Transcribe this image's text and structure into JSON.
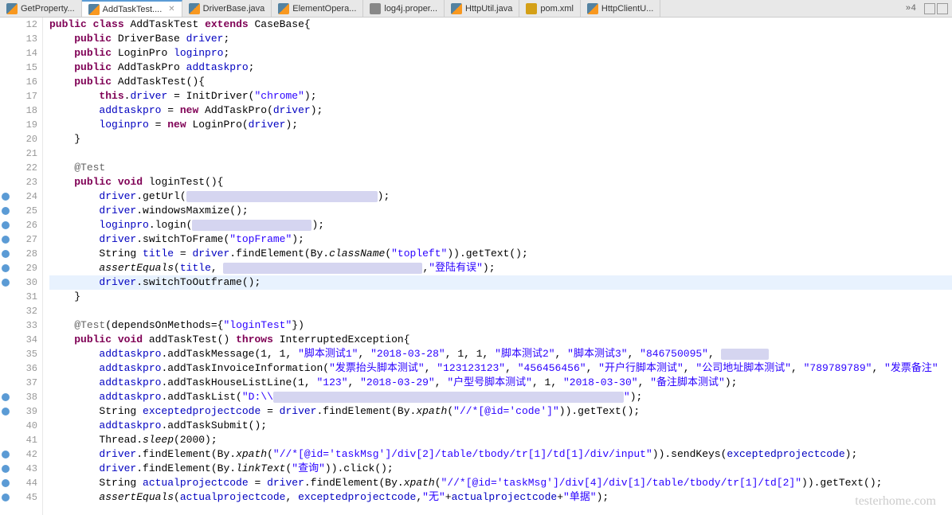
{
  "tabs": [
    {
      "label": "GetProperty...",
      "icon": "java",
      "active": false
    },
    {
      "label": "AddTaskTest....",
      "icon": "java",
      "active": true,
      "closable": true
    },
    {
      "label": "DriverBase.java",
      "icon": "java",
      "active": false
    },
    {
      "label": "ElementOpera...",
      "icon": "java",
      "active": false
    },
    {
      "label": "log4j.proper...",
      "icon": "props",
      "active": false
    },
    {
      "label": "HttpUtil.java",
      "icon": "java",
      "active": false
    },
    {
      "label": "pom.xml",
      "icon": "xml",
      "active": false
    },
    {
      "label": "HttpClientU...",
      "icon": "java",
      "active": false
    }
  ],
  "tabs_more": "»4",
  "watermark": "testerhome.com",
  "lines": [
    {
      "n": 12,
      "html": "<span class='kw'>public</span> <span class='kw'>class</span> AddTaskTest <span class='kw'>extends</span> CaseBase{"
    },
    {
      "n": 13,
      "html": "    <span class='kw'>public</span> DriverBase <span class='field'>driver</span>;"
    },
    {
      "n": 14,
      "html": "    <span class='kw'>public</span> LoginPro <span class='field'>loginpro</span>;"
    },
    {
      "n": 15,
      "html": "    <span class='kw'>public</span> AddTaskPro <span class='field'>addtaskpro</span>;"
    },
    {
      "n": 16,
      "html": "    <span class='kw'>public</span> AddTaskTest(){",
      "fold": true
    },
    {
      "n": 17,
      "html": "        <span class='kw'>this</span>.<span class='field'>driver</span> = InitDriver(<span class='str'>\"chrome\"</span>);"
    },
    {
      "n": 18,
      "html": "        <span class='field'>addtaskpro</span> = <span class='kw'>new</span> AddTaskPro(<span class='field'>driver</span>);"
    },
    {
      "n": 19,
      "html": "        <span class='field'>loginpro</span> = <span class='kw'>new</span> LoginPro(<span class='field'>driver</span>);"
    },
    {
      "n": 20,
      "html": "    }"
    },
    {
      "n": 21,
      "html": ""
    },
    {
      "n": 22,
      "html": "    <span class='ann'>@Test</span>",
      "fold": true
    },
    {
      "n": 23,
      "html": "    <span class='kw'>public</span> <span class='kw'>void</span> loginTest(){"
    },
    {
      "n": 24,
      "html": "        <span class='field'>driver</span>.getUrl(<span class='redacted' style='width:240px'></span>);",
      "bp": true
    },
    {
      "n": 25,
      "html": "        <span class='field'>driver</span>.windowsMaxmize();",
      "bp": true
    },
    {
      "n": 26,
      "html": "        <span class='field'>loginpro</span>.login(<span class='redacted' style='width:150px'></span>);",
      "bp": true
    },
    {
      "n": 27,
      "html": "        <span class='field'>driver</span>.switchToFrame(<span class='str'>\"topFrame\"</span>);",
      "bp": true
    },
    {
      "n": 28,
      "html": "        String <span class='field'>title</span> = <span class='field'>driver</span>.findElement(By.<span class='static-method'>className</span>(<span class='str'>\"topleft\"</span>)).getText();",
      "bp": true
    },
    {
      "n": 29,
      "html": "        <span class='static-method'>assertEquals</span>(<span class='field'>title</span>, <span class='redacted' style='width:250px'></span>,<span class='str'>\"登陆有误\"</span>);",
      "bp": true
    },
    {
      "n": 30,
      "html": "        <span class='field'>driver</span>.switchToOutframe();",
      "bp": true,
      "highlight": true
    },
    {
      "n": 31,
      "html": "    }"
    },
    {
      "n": 32,
      "html": ""
    },
    {
      "n": 33,
      "html": "    <span class='ann'>@Test</span>(dependsOnMethods={<span class='str'>\"loginTest\"</span>})",
      "fold": true
    },
    {
      "n": 34,
      "html": "    <span class='kw'>public</span> <span class='kw'>void</span> addTaskTest() <span class='kw'>throws</span> InterruptedException{"
    },
    {
      "n": 35,
      "html": "        <span class='field'>addtaskpro</span>.addTaskMessage(1, 1, <span class='str'>\"脚本测试1\"</span>, <span class='str'>\"2018-03-28\"</span>, 1, 1, <span class='str'>\"脚本测试2\"</span>, <span class='str'>\"脚本测试3\"</span>, <span class='str'>\"846750095\"</span>, <span class='redacted' style='width:60px'></span>"
    },
    {
      "n": 36,
      "html": "        <span class='field'>addtaskpro</span>.addTaskInvoiceInformation(<span class='str'>\"发票抬头脚本测试\"</span>, <span class='str'>\"123123123\"</span>, <span class='str'>\"456456456\"</span>, <span class='str'>\"开户行脚本测试\"</span>, <span class='str'>\"公司地址脚本测试\"</span>, <span class='str'>\"789789789\"</span>, <span class='str'>\"发票备注\"</span>"
    },
    {
      "n": 37,
      "html": "        <span class='field'>addtaskpro</span>.addTaskHouseListLine(1, <span class='str'>\"123\"</span>, <span class='str'>\"2018-03-29\"</span>, <span class='str'>\"户型号脚本测试\"</span>, 1, <span class='str'>\"2018-03-30\"</span>, <span class='str'>\"备注脚本测试\"</span>);"
    },
    {
      "n": 38,
      "html": "        <span class='field'>addtaskpro</span>.addTaskList(<span class='str'>\"D:\\\\</span><span class='redacted' style='width:440px'></span><span class='str'>\"</span>);",
      "bp": true
    },
    {
      "n": 39,
      "html": "        String <span class='field'>exceptedprojectcode</span> = <span class='field'>driver</span>.findElement(By.<span class='static-method'>xpath</span>(<span class='str'>\"//*[@id='code']\"</span>)).getText();",
      "bp": true
    },
    {
      "n": 40,
      "html": "        <span class='field'>addtaskpro</span>.addTaskSubmit();"
    },
    {
      "n": 41,
      "html": "        Thread.<span class='static-method'>sleep</span>(2000);"
    },
    {
      "n": 42,
      "html": "        <span class='field'>driver</span>.findElement(By.<span class='static-method'>xpath</span>(<span class='str'>\"//*[@id='taskMsg']/div[2]/table/tbody/tr[1]/td[1]/div/input\"</span>)).sendKeys(<span class='field'>exceptedprojectcode</span>);",
      "bp": true
    },
    {
      "n": 43,
      "html": "        <span class='field'>driver</span>.findElement(By.<span class='static-method'>linkText</span>(<span class='str'>\"查询\"</span>)).click();",
      "bp": true
    },
    {
      "n": 44,
      "html": "        String <span class='field'>actualprojectcode</span> = <span class='field'>driver</span>.findElement(By.<span class='static-method'>xpath</span>(<span class='str'>\"//*[@id='taskMsg']/div[4]/div[1]/table/tbody/tr[1]/td[2]\"</span>)).getText();",
      "bp": true
    },
    {
      "n": 45,
      "html": "        <span class='static-method'>assertEquals</span>(<span class='field'>actualprojectcode</span>, <span class='field'>exceptedprojectcode</span>,<span class='str'>\"无\"</span>+<span class='field'>actualprojectcode</span>+<span class='str'>\"单据\"</span>);",
      "bp": true
    }
  ]
}
